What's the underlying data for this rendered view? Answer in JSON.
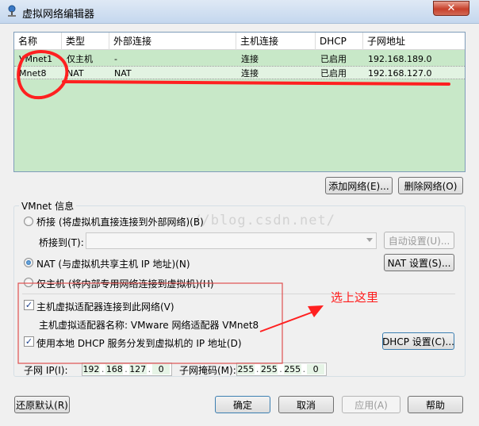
{
  "window": {
    "title": "虚拟网络编辑器",
    "close_label": "✕"
  },
  "network_table": {
    "columns": [
      "名称",
      "类型",
      "外部连接",
      "主机连接",
      "DHCP",
      "子网地址"
    ],
    "rows": [
      {
        "name": "VMnet1",
        "type": "仅主机",
        "external": "-",
        "host": "连接",
        "dhcp": "已启用",
        "subnet": "192.168.189.0"
      },
      {
        "name": "Mnet8",
        "type": "NAT",
        "external": "NAT",
        "host": "连接",
        "dhcp": "已启用",
        "subnet": "192.168.127.0"
      }
    ]
  },
  "table_buttons": {
    "add_network": "添加网络(E)...",
    "remove_network": "删除网络(O)"
  },
  "vmnet_info": {
    "title": "VMnet 信息",
    "bridged_label": "桥接 (将虚拟机直接连接到外部网络)(B)",
    "bridge_to_label": "桥接到(T):",
    "bridge_to_value": "",
    "auto_settings_button": "自动设置(U)...",
    "nat_label": "NAT (与虚拟机共享主机 IP 地址)(N)",
    "nat_settings_button": "NAT 设置(S)...",
    "host_only_label": "仅主机 (将内部专用网络连接到虚拟机)(H)",
    "connect_adapter_label": "主机虚拟适配器连接到此网络(V)",
    "adapter_name_label": "主机虚拟适配器名称: VMware 网络适配器 VMnet8",
    "dhcp_label": "使用本地 DHCP 服务分发到虚拟机的 IP 地址(D)",
    "dhcp_settings_button": "DHCP 设置(C)...",
    "subnet_ip_label": "子网 IP(I):",
    "subnet_ip": [
      "192",
      "168",
      "127",
      "0"
    ],
    "subnet_mask_label": "子网掩码(M):",
    "subnet_mask": [
      "255",
      "255",
      "255",
      "0"
    ],
    "selected_mode": "NAT",
    "connect_adapter_checked": true,
    "dhcp_checked": true
  },
  "footer_buttons": {
    "restore_defaults": "还原默认(R)",
    "ok": "确定",
    "cancel": "取消",
    "apply": "应用(A)",
    "help": "帮助"
  },
  "watermark": "://blog.csdn.net/",
  "annotation": {
    "text": "选上这里",
    "color": "#ff1b1b"
  }
}
